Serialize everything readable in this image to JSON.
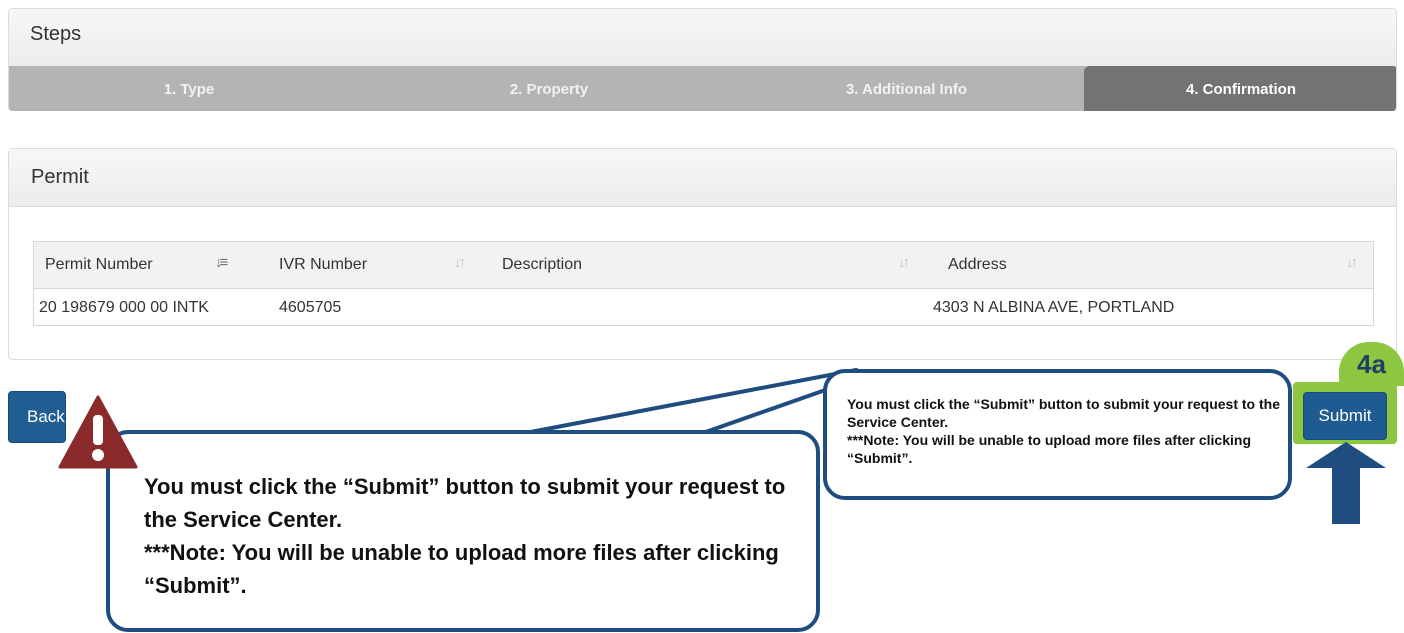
{
  "steps": {
    "title": "Steps",
    "items": [
      "1. Type",
      "2. Property",
      "3. Additional Info",
      "4. Confirmation"
    ]
  },
  "permit": {
    "title": "Permit",
    "columns": [
      "Permit Number",
      "IVR Number",
      "Description",
      "Address"
    ],
    "rows": [
      {
        "permit_number": "20 198679 000 00 INTK",
        "ivr_number": "4605705",
        "description": "",
        "address": "4303 N ALBINA AVE, PORTLAND"
      }
    ]
  },
  "buttons": {
    "back": "Back",
    "submit": "Submit"
  },
  "badge": "4a",
  "callout": {
    "line1": "You must click the “Submit” button to submit your request to the Service Center.",
    "line2": "***Note: You will be unable to upload more files after clicking “Submit”."
  },
  "colors": {
    "primary": "#1f5d93",
    "highlight": "#8dc63f",
    "callout_border": "#1f4d80",
    "warning": "#8b2a2a",
    "active_step": "#737373"
  }
}
